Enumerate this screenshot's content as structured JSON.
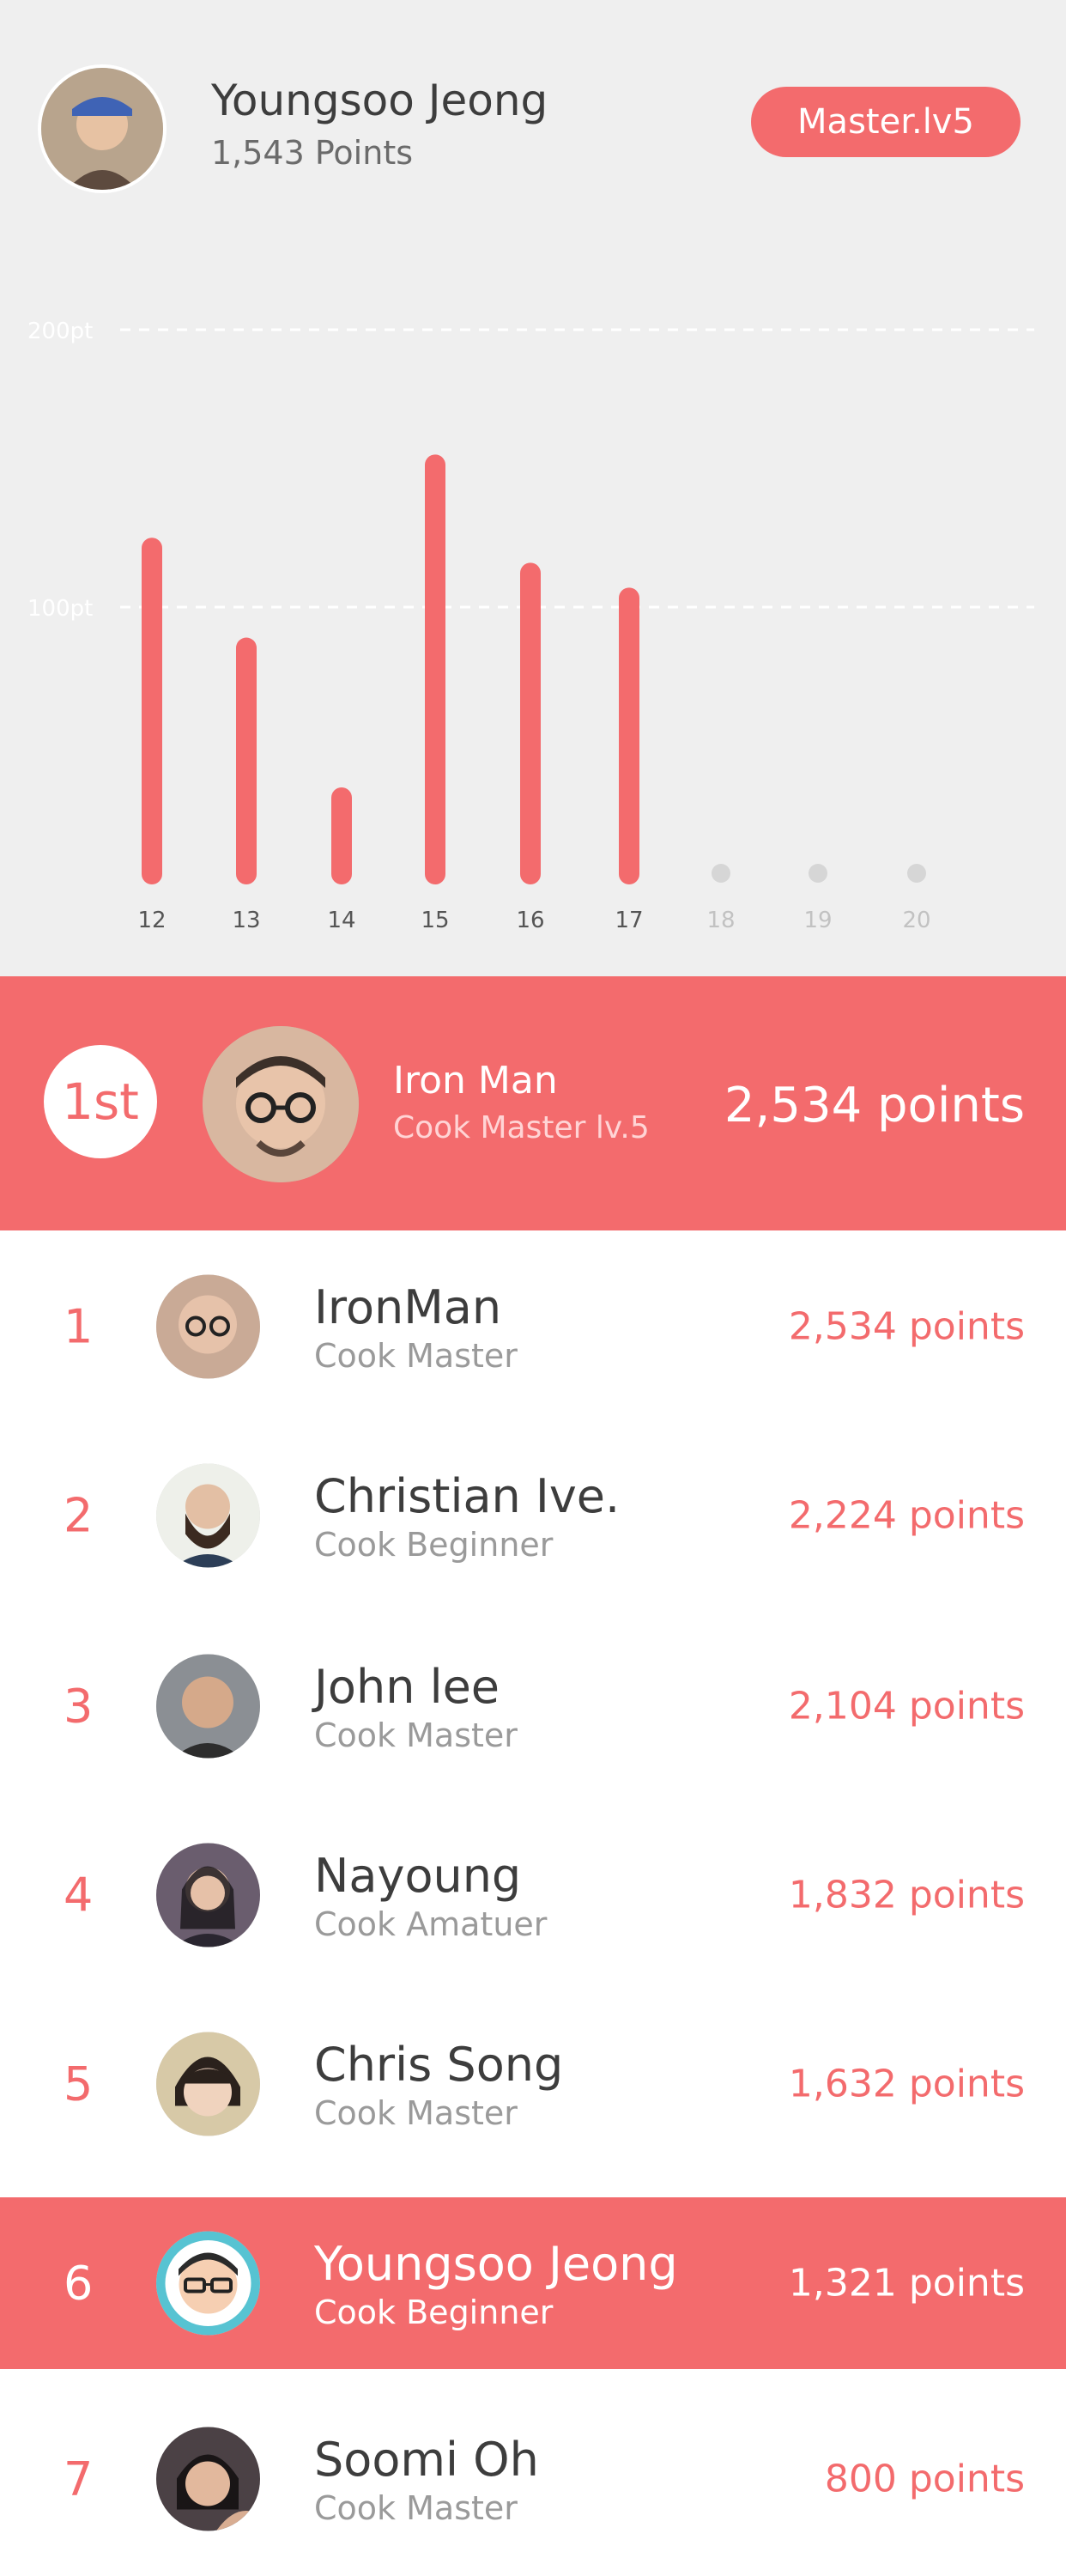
{
  "profile": {
    "name": "Youngsoo Jeong",
    "points": "1,543 Points",
    "level": "Master.lv5"
  },
  "colors": {
    "accent": "#f36b6d",
    "top_background": "#efefef",
    "text_dark": "#3d3d3d",
    "text_muted": "#9a9a9a"
  },
  "chart_data": {
    "type": "bar",
    "categories": [
      "12",
      "13",
      "14",
      "15",
      "16",
      "17",
      "18",
      "19",
      "20"
    ],
    "values": [
      125,
      89,
      35,
      155,
      116,
      107,
      null,
      null,
      null
    ],
    "ytick_labels": [
      "200pt",
      "100pt"
    ],
    "ytick_values": [
      200,
      100
    ],
    "ylim": [
      0,
      200
    ],
    "gridlines": "dashed"
  },
  "top_ranker": {
    "rank": "1st",
    "name": "Iron Man",
    "level": "Cook Master lv.5",
    "points": "2,534 points"
  },
  "leaderboard": [
    {
      "rank": "1",
      "name": "IronMan",
      "title": "Cook Master",
      "points": "2,534 points",
      "highlight": false
    },
    {
      "rank": "2",
      "name": "Christian Ive.",
      "title": "Cook Beginner",
      "points": "2,224 points",
      "highlight": false
    },
    {
      "rank": "3",
      "name": "John lee",
      "title": "Cook Master",
      "points": "2,104 points",
      "highlight": false
    },
    {
      "rank": "4",
      "name": "Nayoung",
      "title": "Cook Amatuer",
      "points": "1,832 points",
      "highlight": false
    },
    {
      "rank": "5",
      "name": "Chris Song",
      "title": "Cook Master",
      "points": "1,632 points",
      "highlight": false
    },
    {
      "rank": "6",
      "name": "Youngsoo Jeong",
      "title": "Cook Beginner",
      "points": "1,321 points",
      "highlight": true
    },
    {
      "rank": "7",
      "name": "Soomi Oh",
      "title": "Cook Master",
      "points": "800 points",
      "highlight": false
    }
  ]
}
